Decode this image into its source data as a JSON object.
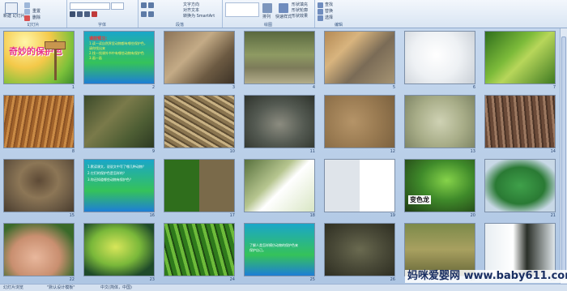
{
  "ribbon": {
    "groups": [
      {
        "label": "幻灯片"
      },
      {
        "label": "字体"
      },
      {
        "label": "段落"
      },
      {
        "label": "绘图"
      },
      {
        "label": "编辑"
      }
    ],
    "new_slide_label": "新建\n幻灯片",
    "reset_label": "重置",
    "delete_label": "删除",
    "text_direction_label": "文字方向",
    "align_text_label": "对齐文本",
    "smartart_label": "转换为 SmartArt",
    "arrange_label": "排列",
    "quick_styles_label": "快速样式",
    "shape_fill_label": "形状填充",
    "shape_outline_label": "形状轮廓",
    "shape_effects_label": "形状效果",
    "find_label": "查找",
    "replace_label": "替换",
    "select_label": "选择"
  },
  "slides": [
    {
      "num": "1",
      "title": "奇妙的保护色"
    },
    {
      "num": "2",
      "title": "课前预习：",
      "lines": [
        "1.读一读自然界里动物都有哪些保护色，",
        "请你找出来",
        "2.找一找课外书中有哪些动物有保护色",
        "3.画一画"
      ]
    },
    {
      "num": "3"
    },
    {
      "num": "4"
    },
    {
      "num": "5"
    },
    {
      "num": "6"
    },
    {
      "num": "7"
    },
    {
      "num": "8"
    },
    {
      "num": "9"
    },
    {
      "num": "10"
    },
    {
      "num": "11"
    },
    {
      "num": "12"
    },
    {
      "num": "13"
    },
    {
      "num": "14"
    },
    {
      "num": "15"
    },
    {
      "num": "16",
      "lines": [
        "1.默读课文，说说文中写了哪几种动物？",
        "2.它们的保护色是怎样的？",
        "3.你还知道哪些动物有保护色？"
      ]
    },
    {
      "num": "17"
    },
    {
      "num": "18"
    },
    {
      "num": "19"
    },
    {
      "num": "20",
      "label": "变色龙"
    },
    {
      "num": "21"
    },
    {
      "num": "22"
    },
    {
      "num": "23"
    },
    {
      "num": "24"
    },
    {
      "num": "25",
      "lines": [
        "了解人类怎样模仿动物的保护色来",
        "保护自己。"
      ]
    },
    {
      "num": "26"
    },
    {
      "num": "27"
    },
    {
      "num": "28"
    }
  ],
  "status": {
    "left": "幻灯片浏览",
    "theme": "\"默认设计模板\"",
    "lang": "中文(简体，中国)"
  },
  "watermark": "妈咪爱婴网 www.baby611.com"
}
